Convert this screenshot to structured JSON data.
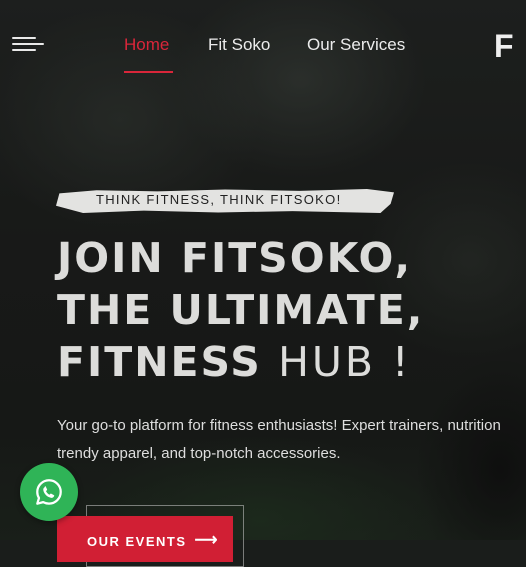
{
  "nav": {
    "items": [
      {
        "label": "Home",
        "active": true
      },
      {
        "label": "Fit Soko",
        "active": false
      },
      {
        "label": "Our Services",
        "active": false
      }
    ],
    "logo_text": "F "
  },
  "hero": {
    "tagline": "THINK FITNESS, THINK FITSOKO!",
    "headline_line1": "JOIN FITSOKO,",
    "headline_line2": "THE ULTIMATE,",
    "headline_line3_bold": "FITNESS",
    "headline_line3_light": "HUB !",
    "description_line1": "Your go-to platform for fitness enthusiasts! Expert trainers, nutrition",
    "description_line2": "trendy apparel, and top-notch accessories.",
    "cta_label": "OUR EVENTS",
    "cta_arrow": "⟶"
  },
  "colors": {
    "accent": "#d11f34",
    "whatsapp": "#2fb457",
    "text": "#dcdcda"
  },
  "icons": [
    "menu-icon",
    "whatsapp-icon",
    "arrow-right-icon"
  ]
}
